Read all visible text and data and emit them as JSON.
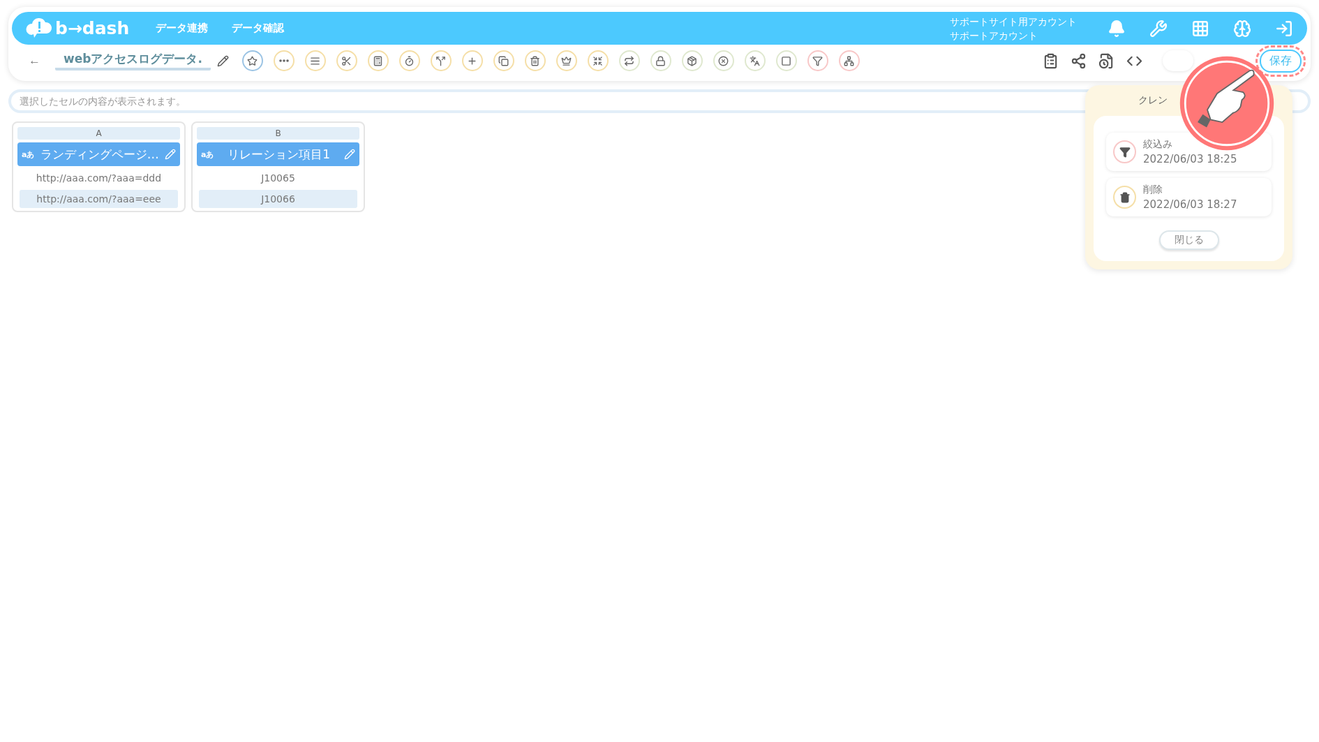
{
  "header": {
    "logo": "b→dash",
    "nav": [
      {
        "label": "データ連携"
      },
      {
        "label": "データ確認"
      }
    ],
    "account": {
      "line_1": "サポートサイト用アカウント",
      "line_2": "サポートアカウント"
    },
    "icons": [
      {
        "kind": "bell"
      },
      {
        "kind": "wrench"
      },
      {
        "kind": "grid"
      },
      {
        "kind": "brain"
      },
      {
        "kind": "logout"
      }
    ]
  },
  "toolbar": {
    "back": "←",
    "title": "webアクセスログデータ.",
    "tools": [
      {
        "kind": "star",
        "color": "#9cc4e4"
      },
      {
        "kind": "dots",
        "color": "#f5dfa8"
      },
      {
        "kind": "lines",
        "color": "#f5dfa8"
      },
      {
        "kind": "scissors",
        "color": "#f5dfa8"
      },
      {
        "kind": "calc",
        "color": "#f5dfa8"
      },
      {
        "kind": "timer",
        "color": "#f5dfa8"
      },
      {
        "kind": "split",
        "color": "#f5dfa8"
      },
      {
        "kind": "plus",
        "color": "#f5dfa8"
      },
      {
        "kind": "copy",
        "color": "#f5dfa8"
      },
      {
        "kind": "trash",
        "color": "#f5dfa8"
      },
      {
        "kind": "crown",
        "color": "#f5dfa8"
      },
      {
        "kind": "shrink",
        "color": "#f5dfa8"
      },
      {
        "kind": "repeat",
        "color": "#dfe8cf"
      },
      {
        "kind": "lock",
        "color": "#dfe8cf"
      },
      {
        "kind": "package",
        "color": "#dfe8cf"
      },
      {
        "kind": "xcircle",
        "color": "#dfe8cf"
      },
      {
        "kind": "translate",
        "color": "#dfe8cf"
      },
      {
        "kind": "square",
        "color": "#dfe8cf"
      },
      {
        "kind": "filter",
        "color": "#f8c8c8"
      },
      {
        "kind": "network",
        "color": "#f8c8c8"
      }
    ],
    "actions": [
      {
        "kind": "clipboard"
      },
      {
        "kind": "share"
      },
      {
        "kind": "file"
      },
      {
        "kind": "code"
      }
    ],
    "save": {
      "label": "保存",
      "highlighted": true
    }
  },
  "cell_bar": {
    "placeholder": "選択したセルの内容が表示されます。"
  },
  "sheet": {
    "columns": [
      {
        "letter": "A",
        "type": "aあ",
        "title": "ランディングページ…",
        "rows": [
          {
            "value": "http://aaa.com/?aaa=ddd",
            "selected": false
          },
          {
            "value": "http://aaa.com/?aaa=eee",
            "selected": true
          }
        ]
      },
      {
        "letter": "B",
        "type": "aあ",
        "title": "リレーション項目1",
        "rows": [
          {
            "value": "J10065",
            "selected": false
          },
          {
            "value": "J10066",
            "selected": true
          }
        ]
      }
    ]
  },
  "history_panel": {
    "title": "クレン",
    "entries": [
      {
        "kind": "filter",
        "label": "絞込み",
        "time": "2022/06/03 18:25",
        "color": "#f8c8c8"
      },
      {
        "kind": "delete",
        "label": "削除",
        "time": "2022/06/03 18:27",
        "color": "#f5dfa8"
      }
    ],
    "close": "閉じる"
  }
}
